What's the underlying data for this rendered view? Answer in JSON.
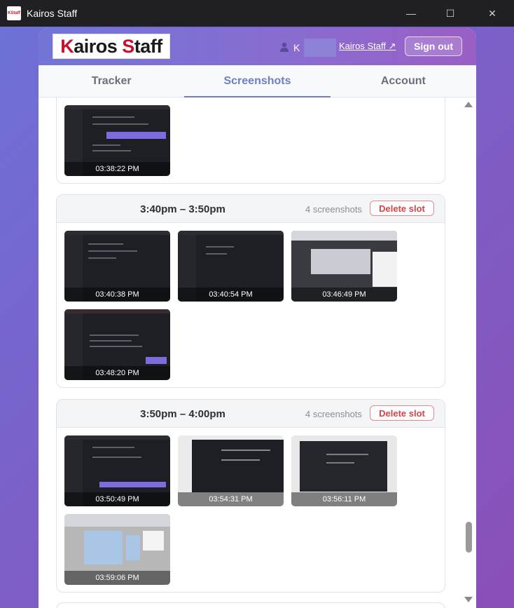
{
  "window": {
    "title": "Kairos Staff",
    "icon_text": "KStaff",
    "minimize": "—",
    "maximize": "☐",
    "close": "✕"
  },
  "header": {
    "logo_first": "K",
    "logo_rest1": "airos ",
    "logo_s": "S",
    "logo_rest2": "taff",
    "user_initial": "K",
    "external_link": "Kairos Staff ↗",
    "signout_label": "Sign out"
  },
  "tabs": [
    {
      "label": "Tracker",
      "active": false
    },
    {
      "label": "Screenshots",
      "active": true
    },
    {
      "label": "Account",
      "active": false
    }
  ],
  "slots": [
    {
      "time_range": "",
      "count": "",
      "delete_label": "",
      "screenshots": [
        {
          "time": "03:38:22 PM"
        }
      ]
    },
    {
      "time_range": "3:40pm – 3:50pm",
      "count": "4 screenshots",
      "delete_label": "Delete slot",
      "screenshots": [
        {
          "time": "03:40:38 PM"
        },
        {
          "time": "03:40:54 PM"
        },
        {
          "time": "03:46:49 PM"
        },
        {
          "time": "03:48:20 PM"
        }
      ]
    },
    {
      "time_range": "3:50pm – 4:00pm",
      "count": "4 screenshots",
      "delete_label": "Delete slot",
      "screenshots": [
        {
          "time": "03:50:49 PM"
        },
        {
          "time": "03:54:31 PM"
        },
        {
          "time": "03:56:11 PM"
        },
        {
          "time": "03:59:06 PM"
        }
      ]
    }
  ],
  "colors": {
    "accent": "#6e7ec8",
    "danger": "#d0454a",
    "logo_red": "#c8102e"
  }
}
